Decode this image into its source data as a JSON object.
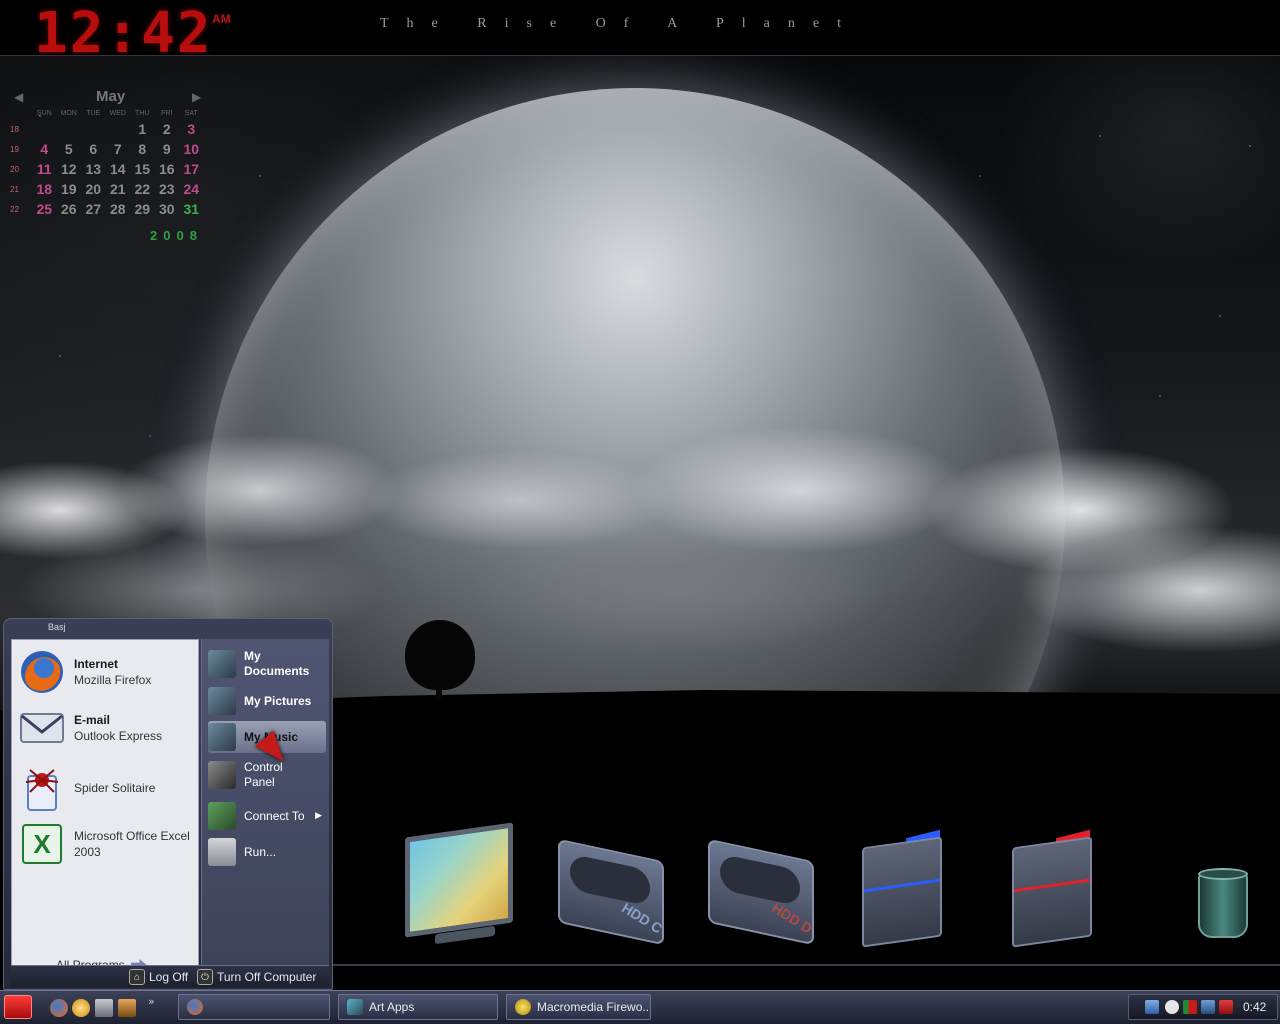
{
  "topbar": {
    "clock": "12:42",
    "ampm": "AM",
    "title": "The Rise Of A Planet"
  },
  "calendar": {
    "month": "May",
    "prev_icon": "chevron-left-icon",
    "next_icon": "chevron-right-icon",
    "days_of_week": [
      "SUN",
      "MON",
      "TUE",
      "WED",
      "THU",
      "FRI",
      "SAT"
    ],
    "weeks": [
      {
        "week": "18",
        "days": [
          "",
          "",
          "",
          "",
          "1",
          "2",
          "3"
        ]
      },
      {
        "week": "19",
        "days": [
          "4",
          "5",
          "6",
          "7",
          "8",
          "9",
          "10"
        ]
      },
      {
        "week": "20",
        "days": [
          "11",
          "12",
          "13",
          "14",
          "15",
          "16",
          "17"
        ]
      },
      {
        "week": "21",
        "days": [
          "18",
          "19",
          "20",
          "21",
          "22",
          "23",
          "24"
        ]
      },
      {
        "week": "22",
        "days": [
          "25",
          "26",
          "27",
          "28",
          "29",
          "30",
          "31"
        ]
      }
    ],
    "year": "2008"
  },
  "start_menu": {
    "user": "Basj",
    "pinned": [
      {
        "title": "Internet",
        "subtitle": "Mozilla Firefox",
        "icon": "firefox-icon"
      },
      {
        "title": "E-mail",
        "subtitle": "Outlook Express",
        "icon": "email-icon"
      }
    ],
    "recent": [
      {
        "title": "Spider Solitaire",
        "icon": "spider-solitaire-icon"
      },
      {
        "title": "Microsoft Office Excel 2003",
        "icon": "excel-icon"
      }
    ],
    "all_programs": "All Programs",
    "right_items": [
      {
        "label": "My Documents",
        "icon": "my-documents-icon"
      },
      {
        "label": "My Pictures",
        "icon": "my-pictures-icon"
      },
      {
        "label": "My Music",
        "icon": "my-music-icon"
      },
      {
        "label": "Control Panel",
        "icon": "control-panel-icon"
      },
      {
        "label": "Connect To",
        "icon": "connect-to-icon"
      },
      {
        "label": "Run...",
        "icon": "run-icon"
      }
    ],
    "log_off": "Log Off",
    "turn_off": "Turn Off Computer"
  },
  "dock": [
    {
      "name": "my-computer-monitor-icon"
    },
    {
      "name": "hdd-c-drive-icon",
      "label": "HDD C"
    },
    {
      "name": "hdd-d-drive-icon",
      "label": "HDD D"
    },
    {
      "name": "removable-drive-blue-icon"
    },
    {
      "name": "removable-drive-red-icon"
    },
    {
      "name": "recycle-bin-icon"
    }
  ],
  "taskbar": {
    "buttons": [
      {
        "label": "",
        "icon": "firefox-icon"
      },
      {
        "label": "Art Apps",
        "icon": "folder-icon"
      },
      {
        "label": "Macromedia Firewo...",
        "icon": "fireworks-icon"
      }
    ],
    "clock": "0:42"
  },
  "colors": {
    "clock_red": "#b80d0d",
    "calendar_weekend": "#c04a8d",
    "calendar_today": "#38b34a",
    "start_button": "#d81a1a"
  }
}
